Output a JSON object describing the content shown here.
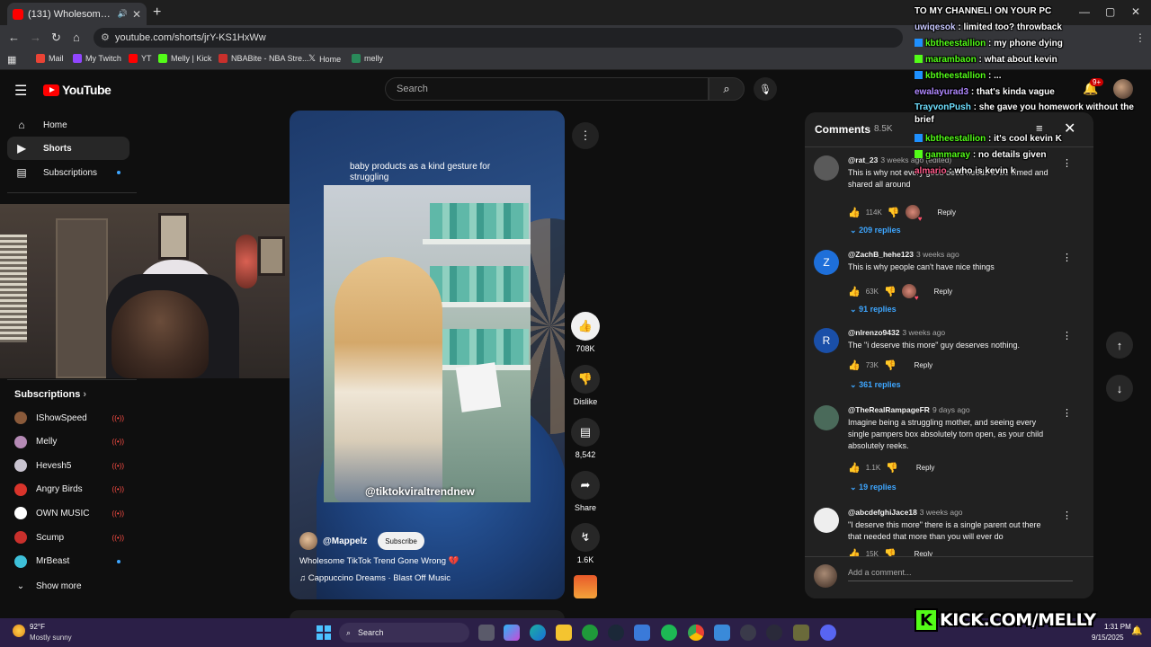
{
  "browser": {
    "tab_title": "(131) Wholesome TikTok Tr",
    "url": "youtube.com/shorts/jrY-KS1HxWw",
    "bookmarks": [
      "Mail",
      "My Twitch",
      "YT",
      "Melly | Kick",
      "NBABite - NBA Stre...",
      "Home",
      "melly"
    ]
  },
  "youtube": {
    "logo_text": "YouTube",
    "search_placeholder": "Search",
    "create_label": "Create",
    "notif_badge": "9+"
  },
  "sidebar": {
    "nav": [
      {
        "label": "Home",
        "icon": "home-icon"
      },
      {
        "label": "Shorts",
        "icon": "shorts-icon"
      },
      {
        "label": "Subscriptions",
        "icon": "subscriptions-icon"
      }
    ],
    "subscriptions_title": "Subscriptions",
    "subscriptions": [
      {
        "name": "IShowSpeed",
        "color": "#8a5a3a",
        "status": "live"
      },
      {
        "name": "Melly",
        "color": "#b58ab5",
        "status": "live"
      },
      {
        "name": "Hevesh5",
        "color": "#c9c4d0",
        "status": "live"
      },
      {
        "name": "Angry Birds",
        "color": "#d9342b",
        "status": "live"
      },
      {
        "name": "OWN MUSIC",
        "color": "#ffffff",
        "status": "live"
      },
      {
        "name": "Scump",
        "color": "#c9302c",
        "status": "live"
      },
      {
        "name": "MrBeast",
        "color": "#3ec0d9",
        "status": "new"
      }
    ],
    "show_more": "Show more"
  },
  "short": {
    "caption": "baby products as a kind gesture for struggling",
    "watermark": "@tiktokviraltrendnew",
    "channel": "@Mappelz",
    "subscribe": "Subscribe",
    "title": "Wholesome TikTok Trend Gone Wrong 💔",
    "music": "♫ Cappuccino Dreams · Blast Off Music",
    "actions": {
      "likes": "708K",
      "dislike": "Dislike",
      "comments": "8,542",
      "share": "Share",
      "remix": "1.6K"
    }
  },
  "comments": {
    "title": "Comments",
    "count": "8.5K",
    "add_placeholder": "Add a comment...",
    "reply_label": "Reply",
    "items": [
      {
        "author": "@rat_23",
        "time": "3 weeks ago (edited)",
        "text": "This is why not every good deed needs to be filmed and shared all around",
        "likes": "114K",
        "hearted": true,
        "replies": "209 replies",
        "avatar_letter": "",
        "avatar_color": "#5a5a5a"
      },
      {
        "author": "@ZachB_hehe123",
        "time": "3 weeks ago",
        "text": "This is why people can't have nice things",
        "likes": "63K",
        "hearted": true,
        "replies": "91 replies",
        "avatar_letter": "Z",
        "avatar_color": "#1e6fd9"
      },
      {
        "author": "@nlrenzo9432",
        "time": "3 weeks ago",
        "text": "The \"i deserve this more\" guy deserves nothing.",
        "likes": "73K",
        "hearted": false,
        "replies": "361 replies",
        "avatar_letter": "R",
        "avatar_color": "#1a4fa8"
      },
      {
        "author": "@TheRealRampageFR",
        "time": "9 days ago",
        "text": "Imagine being a struggling mother, and seeing every single pampers box absolutely torn open, as your child absolutely reeks.",
        "likes": "1.1K",
        "hearted": false,
        "replies": "19 replies",
        "avatar_letter": "",
        "avatar_color": "#4a6a5a"
      },
      {
        "author": "@abcdefghiJace18",
        "time": "3 weeks ago",
        "text": "\"I deserve this more\" there is a single parent out there that needed that more than you will ever do",
        "likes": "15K",
        "hearted": false,
        "replies": "",
        "avatar_letter": "",
        "avatar_color": "#eeeeee"
      }
    ]
  },
  "chat": [
    {
      "user": "",
      "msg": "TO MY CHANNEL! ON YOUR PC",
      "color": "#ffffff",
      "badge": ""
    },
    {
      "user": "uwiqesok",
      "msg": ": limited too? throwback",
      "color": "#c8c8ff",
      "badge": ""
    },
    {
      "user": "kbtheestallion",
      "msg": ": my phone dying",
      "color": "#53fc18",
      "badge": "#1e90ff"
    },
    {
      "user": "marambaon",
      "msg": ": what about kevin",
      "color": "#53fc18",
      "badge": "#53fc18"
    },
    {
      "user": "kbtheestallion",
      "msg": ": ...",
      "color": "#53fc18",
      "badge": "#1e90ff"
    },
    {
      "user": "ewalayurad3",
      "msg": ": that's kinda vague",
      "color": "#b088ff",
      "badge": ""
    },
    {
      "user": "TrayvonPush",
      "msg": ": she gave you homework without the brief",
      "color": "#6fe0ff",
      "badge": ""
    },
    {
      "user": "kbtheestallion",
      "msg": ": it's cool kevin K",
      "color": "#53fc18",
      "badge": "#1e90ff"
    },
    {
      "user": "gammaray",
      "msg": ": no details given",
      "color": "#53fc18",
      "badge": "#53fc18"
    },
    {
      "user": "almario",
      "msg": ": who is kevin k",
      "color": "#ff5a8a",
      "badge": ""
    }
  ],
  "taskbar": {
    "temp": "92°F",
    "weather": "Mostly sunny",
    "search": "Search",
    "time": "1:31 PM",
    "date": "9/15/2025"
  },
  "kick_banner": "KICK.COM/MELLY",
  "kick_logo": "K"
}
